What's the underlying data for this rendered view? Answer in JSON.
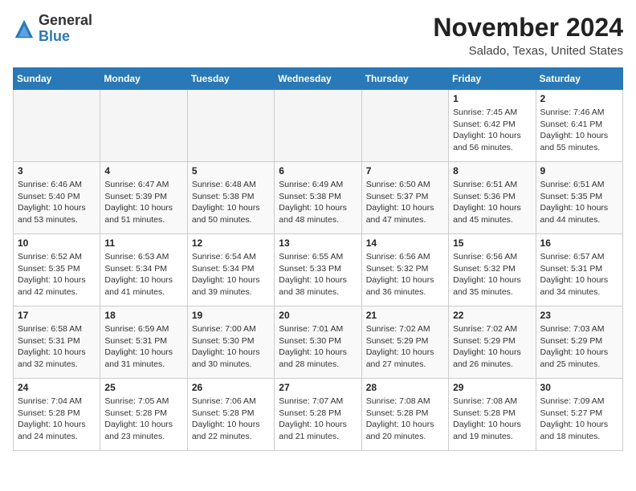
{
  "header": {
    "logo_general": "General",
    "logo_blue": "Blue",
    "month_title": "November 2024",
    "location": "Salado, Texas, United States"
  },
  "calendar": {
    "days_of_week": [
      "Sunday",
      "Monday",
      "Tuesday",
      "Wednesday",
      "Thursday",
      "Friday",
      "Saturday"
    ],
    "weeks": [
      [
        {
          "day": "",
          "info": ""
        },
        {
          "day": "",
          "info": ""
        },
        {
          "day": "",
          "info": ""
        },
        {
          "day": "",
          "info": ""
        },
        {
          "day": "",
          "info": ""
        },
        {
          "day": "1",
          "info": "Sunrise: 7:45 AM\nSunset: 6:42 PM\nDaylight: 10 hours and 56 minutes."
        },
        {
          "day": "2",
          "info": "Sunrise: 7:46 AM\nSunset: 6:41 PM\nDaylight: 10 hours and 55 minutes."
        }
      ],
      [
        {
          "day": "3",
          "info": "Sunrise: 6:46 AM\nSunset: 5:40 PM\nDaylight: 10 hours and 53 minutes."
        },
        {
          "day": "4",
          "info": "Sunrise: 6:47 AM\nSunset: 5:39 PM\nDaylight: 10 hours and 51 minutes."
        },
        {
          "day": "5",
          "info": "Sunrise: 6:48 AM\nSunset: 5:38 PM\nDaylight: 10 hours and 50 minutes."
        },
        {
          "day": "6",
          "info": "Sunrise: 6:49 AM\nSunset: 5:38 PM\nDaylight: 10 hours and 48 minutes."
        },
        {
          "day": "7",
          "info": "Sunrise: 6:50 AM\nSunset: 5:37 PM\nDaylight: 10 hours and 47 minutes."
        },
        {
          "day": "8",
          "info": "Sunrise: 6:51 AM\nSunset: 5:36 PM\nDaylight: 10 hours and 45 minutes."
        },
        {
          "day": "9",
          "info": "Sunrise: 6:51 AM\nSunset: 5:35 PM\nDaylight: 10 hours and 44 minutes."
        }
      ],
      [
        {
          "day": "10",
          "info": "Sunrise: 6:52 AM\nSunset: 5:35 PM\nDaylight: 10 hours and 42 minutes."
        },
        {
          "day": "11",
          "info": "Sunrise: 6:53 AM\nSunset: 5:34 PM\nDaylight: 10 hours and 41 minutes."
        },
        {
          "day": "12",
          "info": "Sunrise: 6:54 AM\nSunset: 5:34 PM\nDaylight: 10 hours and 39 minutes."
        },
        {
          "day": "13",
          "info": "Sunrise: 6:55 AM\nSunset: 5:33 PM\nDaylight: 10 hours and 38 minutes."
        },
        {
          "day": "14",
          "info": "Sunrise: 6:56 AM\nSunset: 5:32 PM\nDaylight: 10 hours and 36 minutes."
        },
        {
          "day": "15",
          "info": "Sunrise: 6:56 AM\nSunset: 5:32 PM\nDaylight: 10 hours and 35 minutes."
        },
        {
          "day": "16",
          "info": "Sunrise: 6:57 AM\nSunset: 5:31 PM\nDaylight: 10 hours and 34 minutes."
        }
      ],
      [
        {
          "day": "17",
          "info": "Sunrise: 6:58 AM\nSunset: 5:31 PM\nDaylight: 10 hours and 32 minutes."
        },
        {
          "day": "18",
          "info": "Sunrise: 6:59 AM\nSunset: 5:31 PM\nDaylight: 10 hours and 31 minutes."
        },
        {
          "day": "19",
          "info": "Sunrise: 7:00 AM\nSunset: 5:30 PM\nDaylight: 10 hours and 30 minutes."
        },
        {
          "day": "20",
          "info": "Sunrise: 7:01 AM\nSunset: 5:30 PM\nDaylight: 10 hours and 28 minutes."
        },
        {
          "day": "21",
          "info": "Sunrise: 7:02 AM\nSunset: 5:29 PM\nDaylight: 10 hours and 27 minutes."
        },
        {
          "day": "22",
          "info": "Sunrise: 7:02 AM\nSunset: 5:29 PM\nDaylight: 10 hours and 26 minutes."
        },
        {
          "day": "23",
          "info": "Sunrise: 7:03 AM\nSunset: 5:29 PM\nDaylight: 10 hours and 25 minutes."
        }
      ],
      [
        {
          "day": "24",
          "info": "Sunrise: 7:04 AM\nSunset: 5:28 PM\nDaylight: 10 hours and 24 minutes."
        },
        {
          "day": "25",
          "info": "Sunrise: 7:05 AM\nSunset: 5:28 PM\nDaylight: 10 hours and 23 minutes."
        },
        {
          "day": "26",
          "info": "Sunrise: 7:06 AM\nSunset: 5:28 PM\nDaylight: 10 hours and 22 minutes."
        },
        {
          "day": "27",
          "info": "Sunrise: 7:07 AM\nSunset: 5:28 PM\nDaylight: 10 hours and 21 minutes."
        },
        {
          "day": "28",
          "info": "Sunrise: 7:08 AM\nSunset: 5:28 PM\nDaylight: 10 hours and 20 minutes."
        },
        {
          "day": "29",
          "info": "Sunrise: 7:08 AM\nSunset: 5:28 PM\nDaylight: 10 hours and 19 minutes."
        },
        {
          "day": "30",
          "info": "Sunrise: 7:09 AM\nSunset: 5:27 PM\nDaylight: 10 hours and 18 minutes."
        }
      ]
    ]
  }
}
